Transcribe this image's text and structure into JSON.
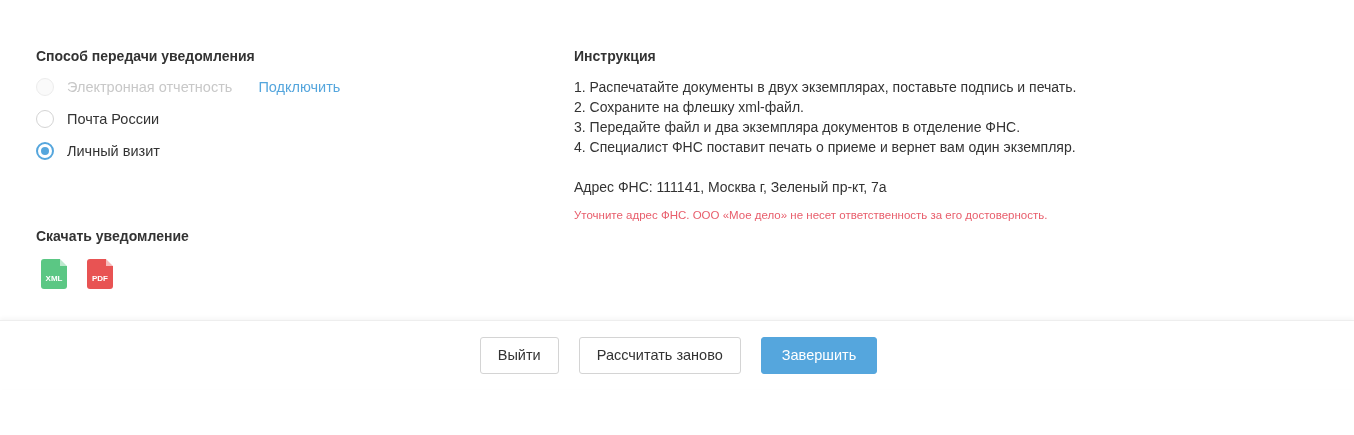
{
  "delivery": {
    "title": "Способ передачи уведомления",
    "options": [
      {
        "label": "Электронная отчетность",
        "selected": false,
        "disabled": true,
        "link": "Подключить"
      },
      {
        "label": "Почта России",
        "selected": false,
        "disabled": false
      },
      {
        "label": "Личный визит",
        "selected": true,
        "disabled": false
      }
    ]
  },
  "instruction": {
    "title": "Инструкция",
    "steps": [
      "1. Распечатайте документы в двух экземплярах, поставьте подпись и печать.",
      "2. Сохраните на флешку xml-файл.",
      "3. Передайте файл и два экземпляра документов в отделение ФНС.",
      "4. Специалист ФНС поставит печать о приеме и вернет вам один экземпляр."
    ],
    "address": "Адрес ФНС: 111141, Москва г, Зеленый пр-кт, 7а",
    "warning": "Уточните адрес ФНС. ООО «Мое дело» не несет ответственность за его достоверность."
  },
  "download": {
    "title": "Скачать уведомление",
    "files": [
      {
        "kind": "xml",
        "label": "XML"
      },
      {
        "kind": "pdf",
        "label": "PDF"
      }
    ]
  },
  "buttons": [
    {
      "label": "Выйти",
      "kind": "secondary"
    },
    {
      "label": "Рассчитать заново",
      "kind": "secondary"
    },
    {
      "label": "Завершить",
      "kind": "primary"
    }
  ]
}
